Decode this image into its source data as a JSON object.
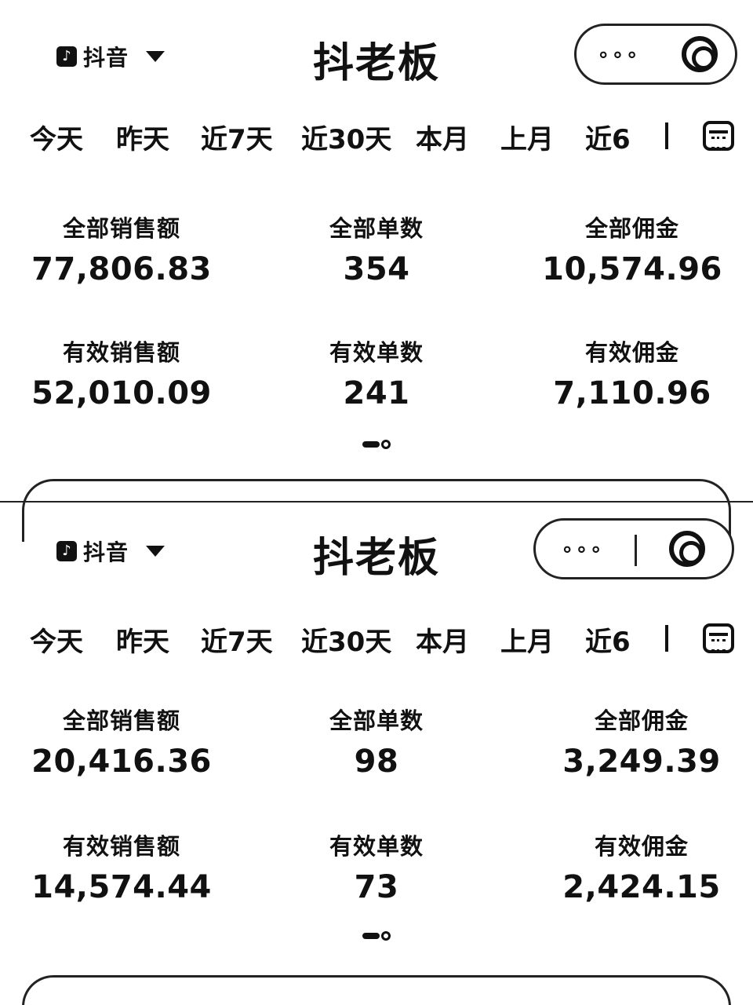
{
  "panels": [
    {
      "app_name": "抖音",
      "title": "抖老板",
      "more_label": "∘∘∘",
      "tabs": [
        "今天",
        "昨天",
        "近7天",
        "近30天",
        "本月",
        "上月",
        "近6"
      ],
      "metrics": [
        {
          "label": "全部销售额",
          "value": "77,806.83"
        },
        {
          "label": "全部单数",
          "value": "354"
        },
        {
          "label": "全部佣金",
          "value": "10,574.96"
        },
        {
          "label": "有效销售额",
          "value": "52,010.09"
        },
        {
          "label": "有效单数",
          "value": "241"
        },
        {
          "label": "有效佣金",
          "value": "7,110.96"
        }
      ]
    },
    {
      "app_name": "抖音",
      "title": "抖老板",
      "more_label": "∘∘∘",
      "tabs": [
        "今天",
        "昨天",
        "近7天",
        "近30天",
        "本月",
        "上月",
        "近6"
      ],
      "metrics": [
        {
          "label": "全部销售额",
          "value": "20,416.36"
        },
        {
          "label": "全部单数",
          "value": "98"
        },
        {
          "label": "全部佣金",
          "value": "3,249.39"
        },
        {
          "label": "有效销售额",
          "value": "14,574.44"
        },
        {
          "label": "有效单数",
          "value": "73"
        },
        {
          "label": "有效佣金",
          "value": "2,424.15"
        }
      ]
    }
  ],
  "icons": {
    "app_logo": "douyin-logo-icon",
    "dropdown": "chevron-down-icon",
    "more": "more-dots-icon",
    "close": "target-circle-icon",
    "calendar": "calendar-icon"
  }
}
